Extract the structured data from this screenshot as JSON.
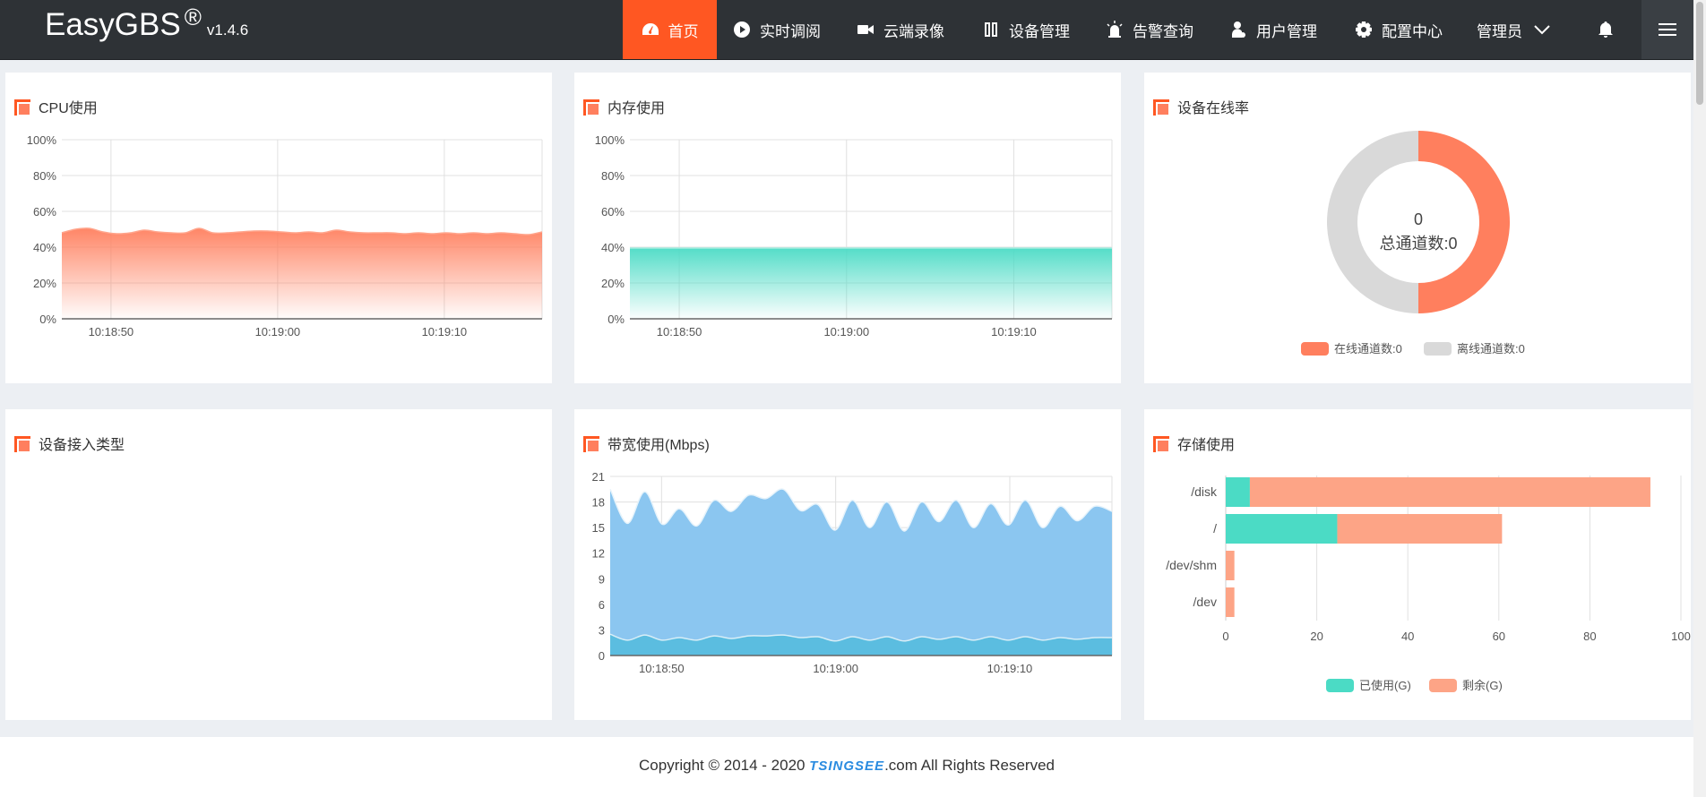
{
  "header": {
    "logo": "EasyGBS",
    "logo_mark": "®",
    "version": "v1.4.6",
    "nav": [
      {
        "label": "首页",
        "icon": "dashboard-icon",
        "active": true
      },
      {
        "label": "实时调阅",
        "icon": "play-icon"
      },
      {
        "label": "云端录像",
        "icon": "video-camera-icon"
      },
      {
        "label": "设备管理",
        "icon": "device-icon"
      },
      {
        "label": "告警查询",
        "icon": "alarm-icon"
      },
      {
        "label": "用户管理",
        "icon": "user-icon"
      },
      {
        "label": "配置中心",
        "icon": "gear-icon"
      }
    ],
    "user": "管理员"
  },
  "colors": {
    "accent": "#ff5722",
    "cpu": "#ff7f5e",
    "memory": "#4bdbc5",
    "bw_total": "#8bc6f0",
    "bw_base": "#5bbde0",
    "used": "#4bdbc5",
    "remain": "#fda486",
    "offline": "#d9d9d9"
  },
  "cards": {
    "cpu": {
      "title": "CPU使用"
    },
    "memory": {
      "title": "内存使用"
    },
    "online": {
      "title": "设备在线率"
    },
    "access": {
      "title": "设备接入类型"
    },
    "bandwidth": {
      "title": "带宽使用(Mbps)"
    },
    "storage": {
      "title": "存储使用"
    }
  },
  "chart_data": [
    {
      "id": "cpu",
      "type": "area",
      "ylim": [
        0,
        100
      ],
      "yticks": [
        "0%",
        "20%",
        "40%",
        "60%",
        "80%",
        "100%"
      ],
      "xticks": [
        "10:18:50",
        "10:19:00",
        "10:19:10",
        "10:19:"
      ],
      "x_start": "10:18:47",
      "x_step_seconds": 1,
      "series": [
        {
          "values": [
            48,
            50,
            50.5,
            48.5,
            47.5,
            48,
            49.5,
            48.5,
            48,
            48,
            50.5,
            48,
            48,
            48.5,
            49,
            49,
            48.5,
            48,
            48.5,
            48,
            49.5,
            48.5,
            48,
            48,
            48,
            47.5,
            48,
            47.5,
            48,
            47.5,
            48,
            47.5,
            48,
            47.5,
            47,
            48.5
          ]
        }
      ]
    },
    {
      "id": "memory",
      "type": "area",
      "ylim": [
        0,
        100
      ],
      "yticks": [
        "0%",
        "20%",
        "40%",
        "60%",
        "80%",
        "100%"
      ],
      "xticks": [
        "10:18:50",
        "10:19:00",
        "10:19:10",
        "10:19:"
      ],
      "series": [
        {
          "values": [
            39.5,
            39.5,
            39.5,
            39.5,
            39.5,
            39.5,
            39.5,
            39.5,
            39.5,
            39.5,
            39.5,
            39.5,
            39.5,
            39.5,
            39.5,
            39.5,
            39.5,
            39.5,
            39.5,
            39.5,
            39.5,
            39.5,
            39.5,
            39.5,
            39.5,
            39.5,
            39.5,
            39.5,
            39.5,
            39.5
          ]
        }
      ]
    },
    {
      "id": "online",
      "type": "pie",
      "center_value": "0",
      "center_label": "总通道数:0",
      "slices": [
        {
          "name": "在线通道数:0",
          "value": 50
        },
        {
          "name": "离线通道数:0",
          "value": 50
        }
      ]
    },
    {
      "id": "bandwidth",
      "type": "area",
      "ylim": [
        0,
        21
      ],
      "yticks": [
        "0",
        "3",
        "6",
        "9",
        "12",
        "15",
        "18",
        "21"
      ],
      "xticks": [
        "10:18:50",
        "10:19:00",
        "10:19:10",
        "10:19:"
      ],
      "series": [
        {
          "values": [
            19.5,
            15.5,
            19.2,
            15.4,
            17.2,
            15.2,
            18.2,
            16.9,
            18.8,
            18.4,
            19.5,
            17,
            17.7,
            14.7,
            18.2,
            15,
            18,
            14.6,
            18,
            15.7,
            18.2,
            15,
            17.8,
            15.3,
            18.2,
            15,
            17.5,
            15.8,
            17.5,
            16.9
          ]
        },
        {
          "values": [
            2.5,
            1.8,
            2.4,
            1.8,
            2.1,
            1.8,
            2.3,
            2.0,
            2.3,
            2.3,
            2.4,
            2.1,
            2.2,
            1.7,
            2.2,
            1.8,
            2.2,
            1.7,
            2.2,
            1.9,
            2.2,
            1.8,
            2.2,
            1.8,
            2.2,
            1.8,
            2.1,
            1.9,
            2.1,
            2.1
          ]
        }
      ]
    },
    {
      "id": "storage",
      "type": "bar",
      "orientation": "horizontal",
      "stacked": true,
      "categories": [
        "/disk",
        "/",
        "/dev/shm",
        "/dev"
      ],
      "xlim": [
        0,
        100
      ],
      "xticks": [
        "0",
        "20",
        "40",
        "60",
        "80",
        "100"
      ],
      "series": [
        {
          "name": "已使用(G)",
          "values": [
            5.3,
            24.5,
            0,
            0
          ]
        },
        {
          "name": "剩余(G)",
          "values": [
            88,
            36.2,
            1.9,
            1.9
          ]
        }
      ]
    }
  ],
  "footer": {
    "prefix": "Copyright © 2014 - 2020 ",
    "brand": "TSINGSEE",
    "suffix": ".com All Rights Reserved"
  }
}
